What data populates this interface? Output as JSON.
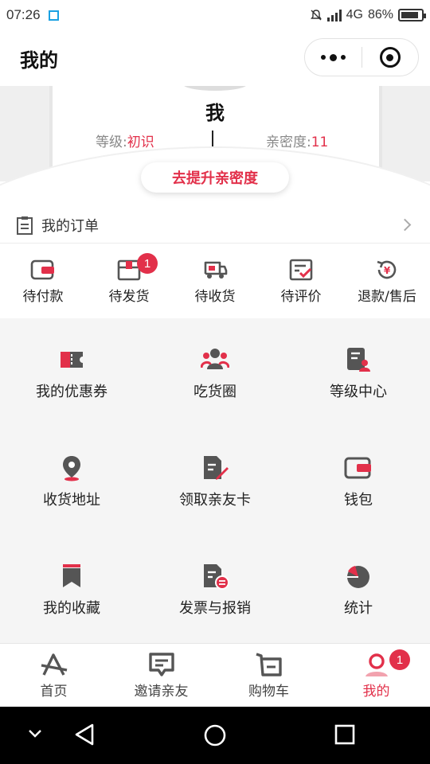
{
  "status_bar": {
    "time": "07:26",
    "network": "4G",
    "battery": "86%",
    "battery_level": 0.86
  },
  "header": {
    "title": "我的"
  },
  "profile": {
    "name": "我",
    "level_label": "等级:",
    "level_value": "初识",
    "intimacy_label": "亲密度:",
    "intimacy_value": "11",
    "boost_button": "去提升亲密度"
  },
  "orders": {
    "title": "我的订单",
    "items": [
      {
        "label": "待付款",
        "icon": "wallet-icon"
      },
      {
        "label": "待发货",
        "icon": "package-icon",
        "badge": "1"
      },
      {
        "label": "待收货",
        "icon": "truck-icon"
      },
      {
        "label": "待评价",
        "icon": "review-icon"
      },
      {
        "label": "退款/售后",
        "icon": "refund-icon"
      }
    ]
  },
  "services": [
    {
      "label": "我的优惠券",
      "icon": "coupon-icon"
    },
    {
      "label": "吃货圈",
      "icon": "group-icon"
    },
    {
      "label": "等级中心",
      "icon": "level-center-icon"
    },
    {
      "label": "收货地址",
      "icon": "location-icon"
    },
    {
      "label": "领取亲友卡",
      "icon": "card-edit-icon"
    },
    {
      "label": "钱包",
      "icon": "wallet-icon"
    },
    {
      "label": "我的收藏",
      "icon": "bookmark-icon"
    },
    {
      "label": "发票与报销",
      "icon": "invoice-icon"
    },
    {
      "label": "统计",
      "icon": "pie-chart-icon"
    }
  ],
  "tabbar": [
    {
      "label": "首页",
      "icon": "home-icon"
    },
    {
      "label": "邀请亲友",
      "icon": "chat-icon"
    },
    {
      "label": "购物车",
      "icon": "cart-icon"
    },
    {
      "label": "我的",
      "icon": "profile-icon",
      "badge": "1",
      "active": true
    }
  ],
  "colors": {
    "accent": "#e2304a",
    "icon_gray": "#555555"
  }
}
